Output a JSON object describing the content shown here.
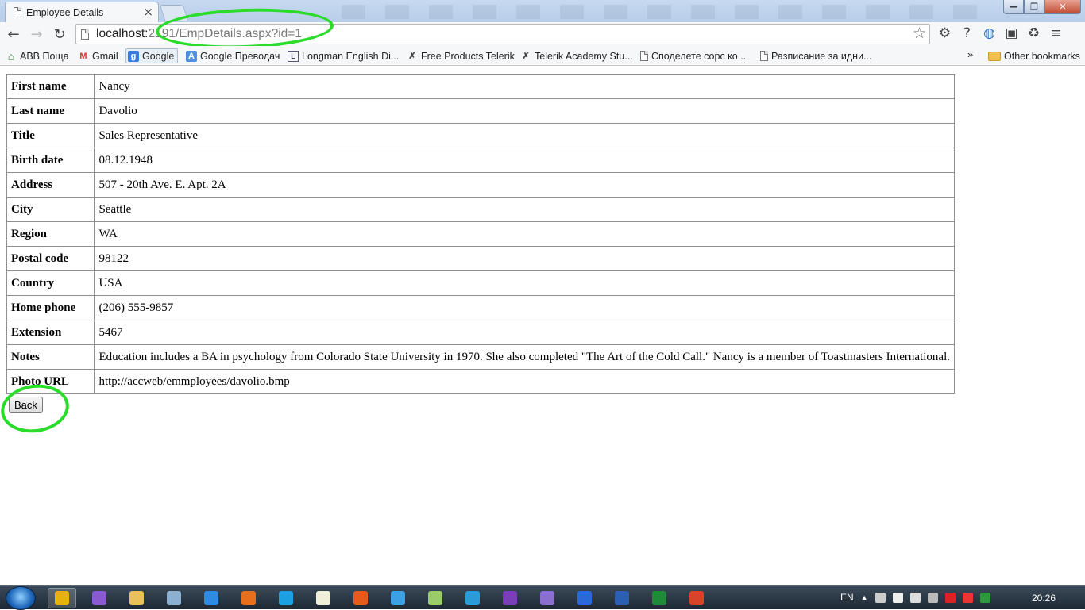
{
  "browser": {
    "tab_title": "Employee Details",
    "tab_close": "×",
    "url_host": "localhost:",
    "url_rest": "2191/EmpDetails.aspx?id=1",
    "window_controls": {
      "minimize": "—",
      "maximize": "❐",
      "close": "✕"
    },
    "nav": {
      "back": "←",
      "forward": "→",
      "reload": "↻"
    },
    "star": "☆",
    "toolbar_icons": [
      "⚙",
      "?",
      "◍",
      "▣",
      "♻",
      "≡"
    ],
    "bookmarks": [
      {
        "icon": "⌂",
        "label": "АВВ Поща"
      },
      {
        "icon": "M",
        "label": "Gmail"
      },
      {
        "icon": "g",
        "label": "Google"
      },
      {
        "icon": "A",
        "label": "Google Преводач"
      },
      {
        "icon": "L",
        "label": "Longman English Di..."
      },
      {
        "icon": "✗",
        "label": "Free Products Telerik"
      },
      {
        "icon": "✗",
        "label": "Telerik Academy Stu..."
      },
      {
        "icon": "",
        "label": "Споделете сорс ко..."
      },
      {
        "icon": "",
        "label": "Разписание за идни..."
      }
    ],
    "bookmarks_more": "»",
    "other_bookmarks": "Other bookmarks"
  },
  "employee": {
    "rows": [
      {
        "label": "First name",
        "value": "Nancy"
      },
      {
        "label": "Last name",
        "value": "Davolio"
      },
      {
        "label": "Title",
        "value": "Sales Representative"
      },
      {
        "label": "Birth date",
        "value": "08.12.1948"
      },
      {
        "label": "Address",
        "value": "507 - 20th Ave. E. Apt. 2A"
      },
      {
        "label": "City",
        "value": "Seattle"
      },
      {
        "label": "Region",
        "value": "WA"
      },
      {
        "label": "Postal code",
        "value": "98122"
      },
      {
        "label": "Country",
        "value": "USA"
      },
      {
        "label": "Home phone",
        "value": "(206) 555-9857"
      },
      {
        "label": "Extension",
        "value": "5467"
      },
      {
        "label": "Notes",
        "value": "Education includes a BA in psychology from Colorado State University in 1970. She also completed \"The Art of the Cold Call.\" Nancy is a member of Toastmasters International."
      },
      {
        "label": "Photo URL",
        "value": "http://accweb/emmployees/davolio.bmp"
      }
    ],
    "back_label": "Back"
  },
  "taskbar": {
    "items": [
      "chrome",
      "visual-studio",
      "explorer",
      "tools",
      "ie",
      "firefox",
      "skype",
      "notepad",
      "app",
      "app",
      "app",
      "skype",
      "visual-studio",
      "app",
      "photoshop",
      "word",
      "excel",
      "app"
    ],
    "language": "EN",
    "clock": "20:26"
  },
  "colors": {
    "annotation": "#2bdc2b",
    "table_border": "#8f8f8f"
  }
}
